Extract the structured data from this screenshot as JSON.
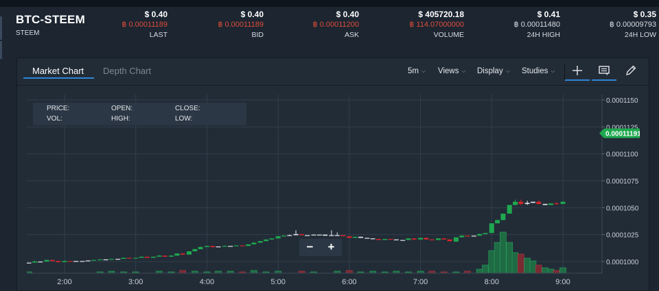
{
  "ticker": {
    "pair": "BTC-STEEM",
    "base": "STEEM",
    "stats": [
      {
        "usd": "$ 0.40",
        "btc": "฿ 0.00011189",
        "label": "LAST",
        "btc_color": "red"
      },
      {
        "usd": "$ 0.40",
        "btc": "฿ 0.00011189",
        "label": "BID",
        "btc_color": "red"
      },
      {
        "usd": "$ 0.40",
        "btc": "฿ 0.00011200",
        "label": "ASK",
        "btc_color": "red"
      },
      {
        "usd": "$ 405720.18",
        "btc": "฿ 114.07000000",
        "label": "VOLUME",
        "btc_color": "red"
      },
      {
        "usd": "$ 0.41",
        "btc": "฿ 0.00011480",
        "label": "24H HIGH",
        "btc_color": "white"
      },
      {
        "usd": "$ 0.35",
        "btc": "฿ 0.00009793",
        "label": "24H LOW",
        "btc_color": "white"
      }
    ]
  },
  "tabs": {
    "market": "Market Chart",
    "depth": "Depth Chart"
  },
  "toolbar": {
    "interval": "5m",
    "views": "Views",
    "display": "Display",
    "studies": "Studies"
  },
  "ohlc": {
    "price": "PRICE:",
    "open": "OPEN:",
    "close": "CLOSE:",
    "vol": "VOL:",
    "high": "HIGH:",
    "low": "LOW:"
  },
  "zoom": {
    "minus": "−",
    "plus": "+"
  },
  "colors": {
    "up": "#1fa84f",
    "down": "#d7262b",
    "grid": "#323e4b",
    "bg": "#222c37",
    "accent": "#2f86d6"
  },
  "chart_data": {
    "type": "candlestick",
    "current_price": "0.00011191",
    "x_ticks": [
      "2:00",
      "3:00",
      "4:00",
      "5:00",
      "6:00",
      "7:00",
      "8:00",
      "9:00"
    ],
    "y_ticks": [
      "0.0001150",
      "0.0001125",
      "0.0001100",
      "0.0001075",
      "0.0001050",
      "0.0001025",
      "0.0001000"
    ],
    "y_tick_values": [
      0.000115,
      0.0001125,
      0.00011,
      0.0001075,
      0.000105,
      0.0001025,
      0.0001
    ],
    "candles": [
      [
        1.33,
        0.999,
        0.9995,
        0.9985,
        1.0005,
        0,
        "up"
      ],
      [
        1.41,
        0.9995,
        0.999,
        0.999,
        1.0005,
        0,
        "down"
      ],
      [
        1.5,
        0.999,
        0.999,
        0.999,
        0.999,
        0,
        "flat"
      ],
      [
        1.58,
        0.999,
        1.0,
        0.999,
        1.001,
        0,
        "up"
      ],
      [
        1.66,
        1.0,
        1.0,
        1.0,
        1.0,
        0,
        "flat"
      ],
      [
        1.75,
        1.0,
        1.0015,
        1.0,
        1.0015,
        0,
        "up"
      ],
      [
        1.83,
        1.0015,
        1.0005,
        1.0,
        1.0015,
        0,
        "down"
      ],
      [
        1.91,
        1.0005,
        0.9995,
        0.999,
        1.0005,
        0,
        "down"
      ],
      [
        2.0,
        0.9995,
        1.0005,
        0.9995,
        1.001,
        0,
        "up"
      ],
      [
        2.08,
        1.0005,
        1.0,
        1.0,
        1.0005,
        0,
        "down"
      ],
      [
        2.16,
        1.0,
        1.0005,
        1.0,
        1.0005,
        0,
        "flat"
      ],
      [
        2.25,
        1.0005,
        1.0005,
        1.0005,
        1.0005,
        0,
        "flat"
      ],
      [
        2.33,
        1.0005,
        1.001,
        1.0005,
        1.001,
        0,
        "flat"
      ],
      [
        2.41,
        1.001,
        1.0015,
        1.001,
        1.0015,
        0,
        "up"
      ],
      [
        2.5,
        1.0015,
        1.002,
        1.0015,
        1.002,
        0,
        "up"
      ],
      [
        2.58,
        1.002,
        1.002,
        1.002,
        1.002,
        0,
        "flat"
      ],
      [
        2.66,
        1.002,
        1.0025,
        1.002,
        1.0025,
        0,
        "up"
      ],
      [
        2.75,
        1.0025,
        1.0025,
        1.0025,
        1.0025,
        0,
        "flat"
      ],
      [
        2.83,
        1.0025,
        1.0035,
        1.0025,
        1.0035,
        0,
        "up"
      ],
      [
        2.91,
        1.0035,
        1.003,
        1.003,
        1.0035,
        0,
        "down"
      ],
      [
        3.0,
        1.003,
        1.0035,
        1.003,
        1.0035,
        0,
        "up"
      ],
      [
        3.08,
        1.0035,
        1.0045,
        1.0035,
        1.0045,
        0,
        "up"
      ],
      [
        3.16,
        1.0045,
        1.0035,
        1.0035,
        1.0045,
        0,
        "down"
      ],
      [
        3.25,
        1.0035,
        1.0045,
        1.0035,
        1.0045,
        0,
        "up"
      ],
      [
        3.33,
        1.0045,
        1.0055,
        1.0045,
        1.006,
        0,
        "up"
      ],
      [
        3.41,
        1.0055,
        1.0045,
        1.0045,
        1.0055,
        0,
        "down"
      ],
      [
        3.5,
        1.0045,
        1.0055,
        1.0045,
        1.006,
        0,
        "up"
      ],
      [
        3.58,
        1.0055,
        1.0075,
        1.0055,
        1.0075,
        0,
        "up"
      ],
      [
        3.66,
        1.0075,
        1.0065,
        1.006,
        1.0075,
        0,
        "down"
      ],
      [
        3.75,
        1.0065,
        1.0095,
        1.0065,
        1.0095,
        0,
        "up"
      ],
      [
        3.83,
        1.0095,
        1.0115,
        1.0095,
        1.012,
        0,
        "up"
      ],
      [
        3.91,
        1.0115,
        1.0135,
        1.0115,
        1.014,
        0,
        "up"
      ],
      [
        4.0,
        1.0135,
        1.0145,
        1.0135,
        1.0145,
        0,
        "up"
      ],
      [
        4.08,
        1.0145,
        1.0135,
        1.013,
        1.0145,
        0,
        "down"
      ],
      [
        4.16,
        1.0135,
        1.014,
        1.0135,
        1.014,
        0,
        "flat"
      ],
      [
        4.25,
        1.014,
        1.0145,
        1.014,
        1.015,
        0,
        "up"
      ],
      [
        4.33,
        1.0145,
        1.0145,
        1.0145,
        1.0145,
        0,
        "flat"
      ],
      [
        4.41,
        1.0145,
        1.015,
        1.0145,
        1.015,
        0,
        "up"
      ],
      [
        4.5,
        1.015,
        1.0145,
        1.0145,
        1.015,
        0,
        "down"
      ],
      [
        4.58,
        1.0145,
        1.016,
        1.0145,
        1.016,
        0,
        "up"
      ],
      [
        4.66,
        1.016,
        1.0175,
        1.016,
        1.018,
        0,
        "up"
      ],
      [
        4.75,
        1.0175,
        1.019,
        1.0175,
        1.019,
        0,
        "up"
      ],
      [
        4.83,
        1.019,
        1.0205,
        1.019,
        1.0205,
        0,
        "up"
      ],
      [
        4.91,
        1.0205,
        1.0215,
        1.0205,
        1.0215,
        0,
        "up"
      ],
      [
        5.0,
        1.0215,
        1.0235,
        1.0215,
        1.0235,
        0,
        "up"
      ],
      [
        5.08,
        1.0235,
        1.024,
        1.0235,
        1.0245,
        0,
        "up"
      ],
      [
        5.16,
        1.024,
        1.0245,
        1.024,
        1.025,
        0,
        "flat"
      ],
      [
        5.25,
        1.0245,
        1.0255,
        1.0245,
        1.029,
        0,
        "flat"
      ],
      [
        5.33,
        1.0255,
        1.0245,
        1.0245,
        1.0255,
        0,
        "down"
      ],
      [
        5.41,
        1.0245,
        1.0245,
        1.0245,
        1.0245,
        0,
        "flat"
      ],
      [
        5.5,
        1.0245,
        1.025,
        1.0245,
        1.025,
        0,
        "flat"
      ],
      [
        5.58,
        1.025,
        1.025,
        1.025,
        1.025,
        0,
        "flat"
      ],
      [
        5.66,
        1.025,
        1.024,
        1.024,
        1.025,
        0,
        "flat"
      ],
      [
        5.75,
        1.024,
        1.0245,
        1.024,
        1.029,
        0,
        "flat"
      ],
      [
        5.83,
        1.0245,
        1.0245,
        1.0245,
        1.027,
        0,
        "flat"
      ],
      [
        5.91,
        1.0245,
        1.0235,
        1.0235,
        1.0245,
        0,
        "down"
      ],
      [
        6.0,
        1.0235,
        1.022,
        1.022,
        1.0235,
        0,
        "down"
      ],
      [
        6.08,
        1.022,
        1.023,
        1.022,
        1.023,
        0,
        "up"
      ],
      [
        6.16,
        1.023,
        1.022,
        1.022,
        1.023,
        0,
        "flat"
      ],
      [
        6.25,
        1.022,
        1.0215,
        1.0215,
        1.022,
        0,
        "flat"
      ],
      [
        6.33,
        1.0215,
        1.021,
        1.021,
        1.0215,
        0,
        "flat"
      ],
      [
        6.41,
        1.021,
        1.02,
        1.02,
        1.021,
        0,
        "down"
      ],
      [
        6.5,
        1.02,
        1.021,
        1.02,
        1.021,
        0,
        "up"
      ],
      [
        6.58,
        1.021,
        1.0205,
        1.0205,
        1.021,
        0,
        "down"
      ],
      [
        6.66,
        1.0205,
        1.02,
        1.02,
        1.0205,
        0,
        "flat"
      ],
      [
        6.75,
        1.02,
        1.02,
        1.02,
        1.02,
        0,
        "flat"
      ],
      [
        6.83,
        1.02,
        1.0215,
        1.02,
        1.0215,
        0,
        "up"
      ],
      [
        6.91,
        1.0215,
        1.0205,
        1.02,
        1.0215,
        0,
        "down"
      ],
      [
        7.0,
        1.0205,
        1.022,
        1.0205,
        1.022,
        0,
        "up"
      ],
      [
        7.08,
        1.022,
        1.0205,
        1.0205,
        1.022,
        0,
        "down"
      ],
      [
        7.16,
        1.0205,
        1.02,
        1.02,
        1.0205,
        0,
        "down"
      ],
      [
        7.25,
        1.02,
        1.0215,
        1.02,
        1.0215,
        0,
        "up"
      ],
      [
        7.33,
        1.0215,
        1.0205,
        1.0205,
        1.0215,
        0,
        "down"
      ],
      [
        7.41,
        1.0205,
        1.019,
        1.0185,
        1.0205,
        0,
        "down"
      ],
      [
        7.5,
        1.0185,
        1.0225,
        1.0185,
        1.0225,
        0,
        "up"
      ],
      [
        7.58,
        1.0225,
        1.024,
        1.0225,
        1.0245,
        0,
        "up"
      ],
      [
        7.66,
        1.024,
        1.0235,
        1.023,
        1.024,
        0,
        "down"
      ],
      [
        7.75,
        1.0235,
        1.024,
        1.0235,
        1.024,
        0,
        "flat"
      ],
      [
        7.83,
        1.024,
        1.0255,
        1.024,
        1.026,
        0,
        "up"
      ],
      [
        7.91,
        1.0255,
        1.0265,
        1.0255,
        1.0265,
        0,
        "up"
      ],
      [
        8.0,
        1.0265,
        1.0355,
        1.0265,
        1.0355,
        0,
        "up"
      ],
      [
        8.08,
        1.0355,
        1.0385,
        1.0355,
        1.039,
        0,
        "up"
      ],
      [
        8.16,
        1.0385,
        1.0445,
        1.0385,
        1.0445,
        0,
        "up"
      ],
      [
        8.25,
        1.0445,
        1.0525,
        1.0445,
        1.0525,
        0,
        "up"
      ],
      [
        8.33,
        1.0525,
        1.0555,
        1.0525,
        1.0575,
        0,
        "up"
      ],
      [
        8.41,
        1.0555,
        1.0535,
        1.0525,
        1.0575,
        0,
        "down"
      ],
      [
        8.5,
        1.0535,
        1.0545,
        1.0525,
        1.0565,
        0,
        "flat"
      ],
      [
        8.58,
        1.0545,
        1.0555,
        1.0545,
        1.0555,
        0,
        "flat"
      ],
      [
        8.66,
        1.0555,
        1.0535,
        1.053,
        1.0565,
        0,
        "down"
      ],
      [
        8.75,
        1.0535,
        1.0525,
        1.0525,
        1.0535,
        0,
        "flat"
      ],
      [
        8.83,
        1.0525,
        1.054,
        1.0525,
        1.054,
        0,
        "up"
      ],
      [
        8.91,
        1.054,
        1.0535,
        1.053,
        1.0555,
        0,
        "down"
      ],
      [
        9.0,
        1.0535,
        1.0555,
        1.0535,
        1.056,
        0,
        "up"
      ]
    ]
  }
}
